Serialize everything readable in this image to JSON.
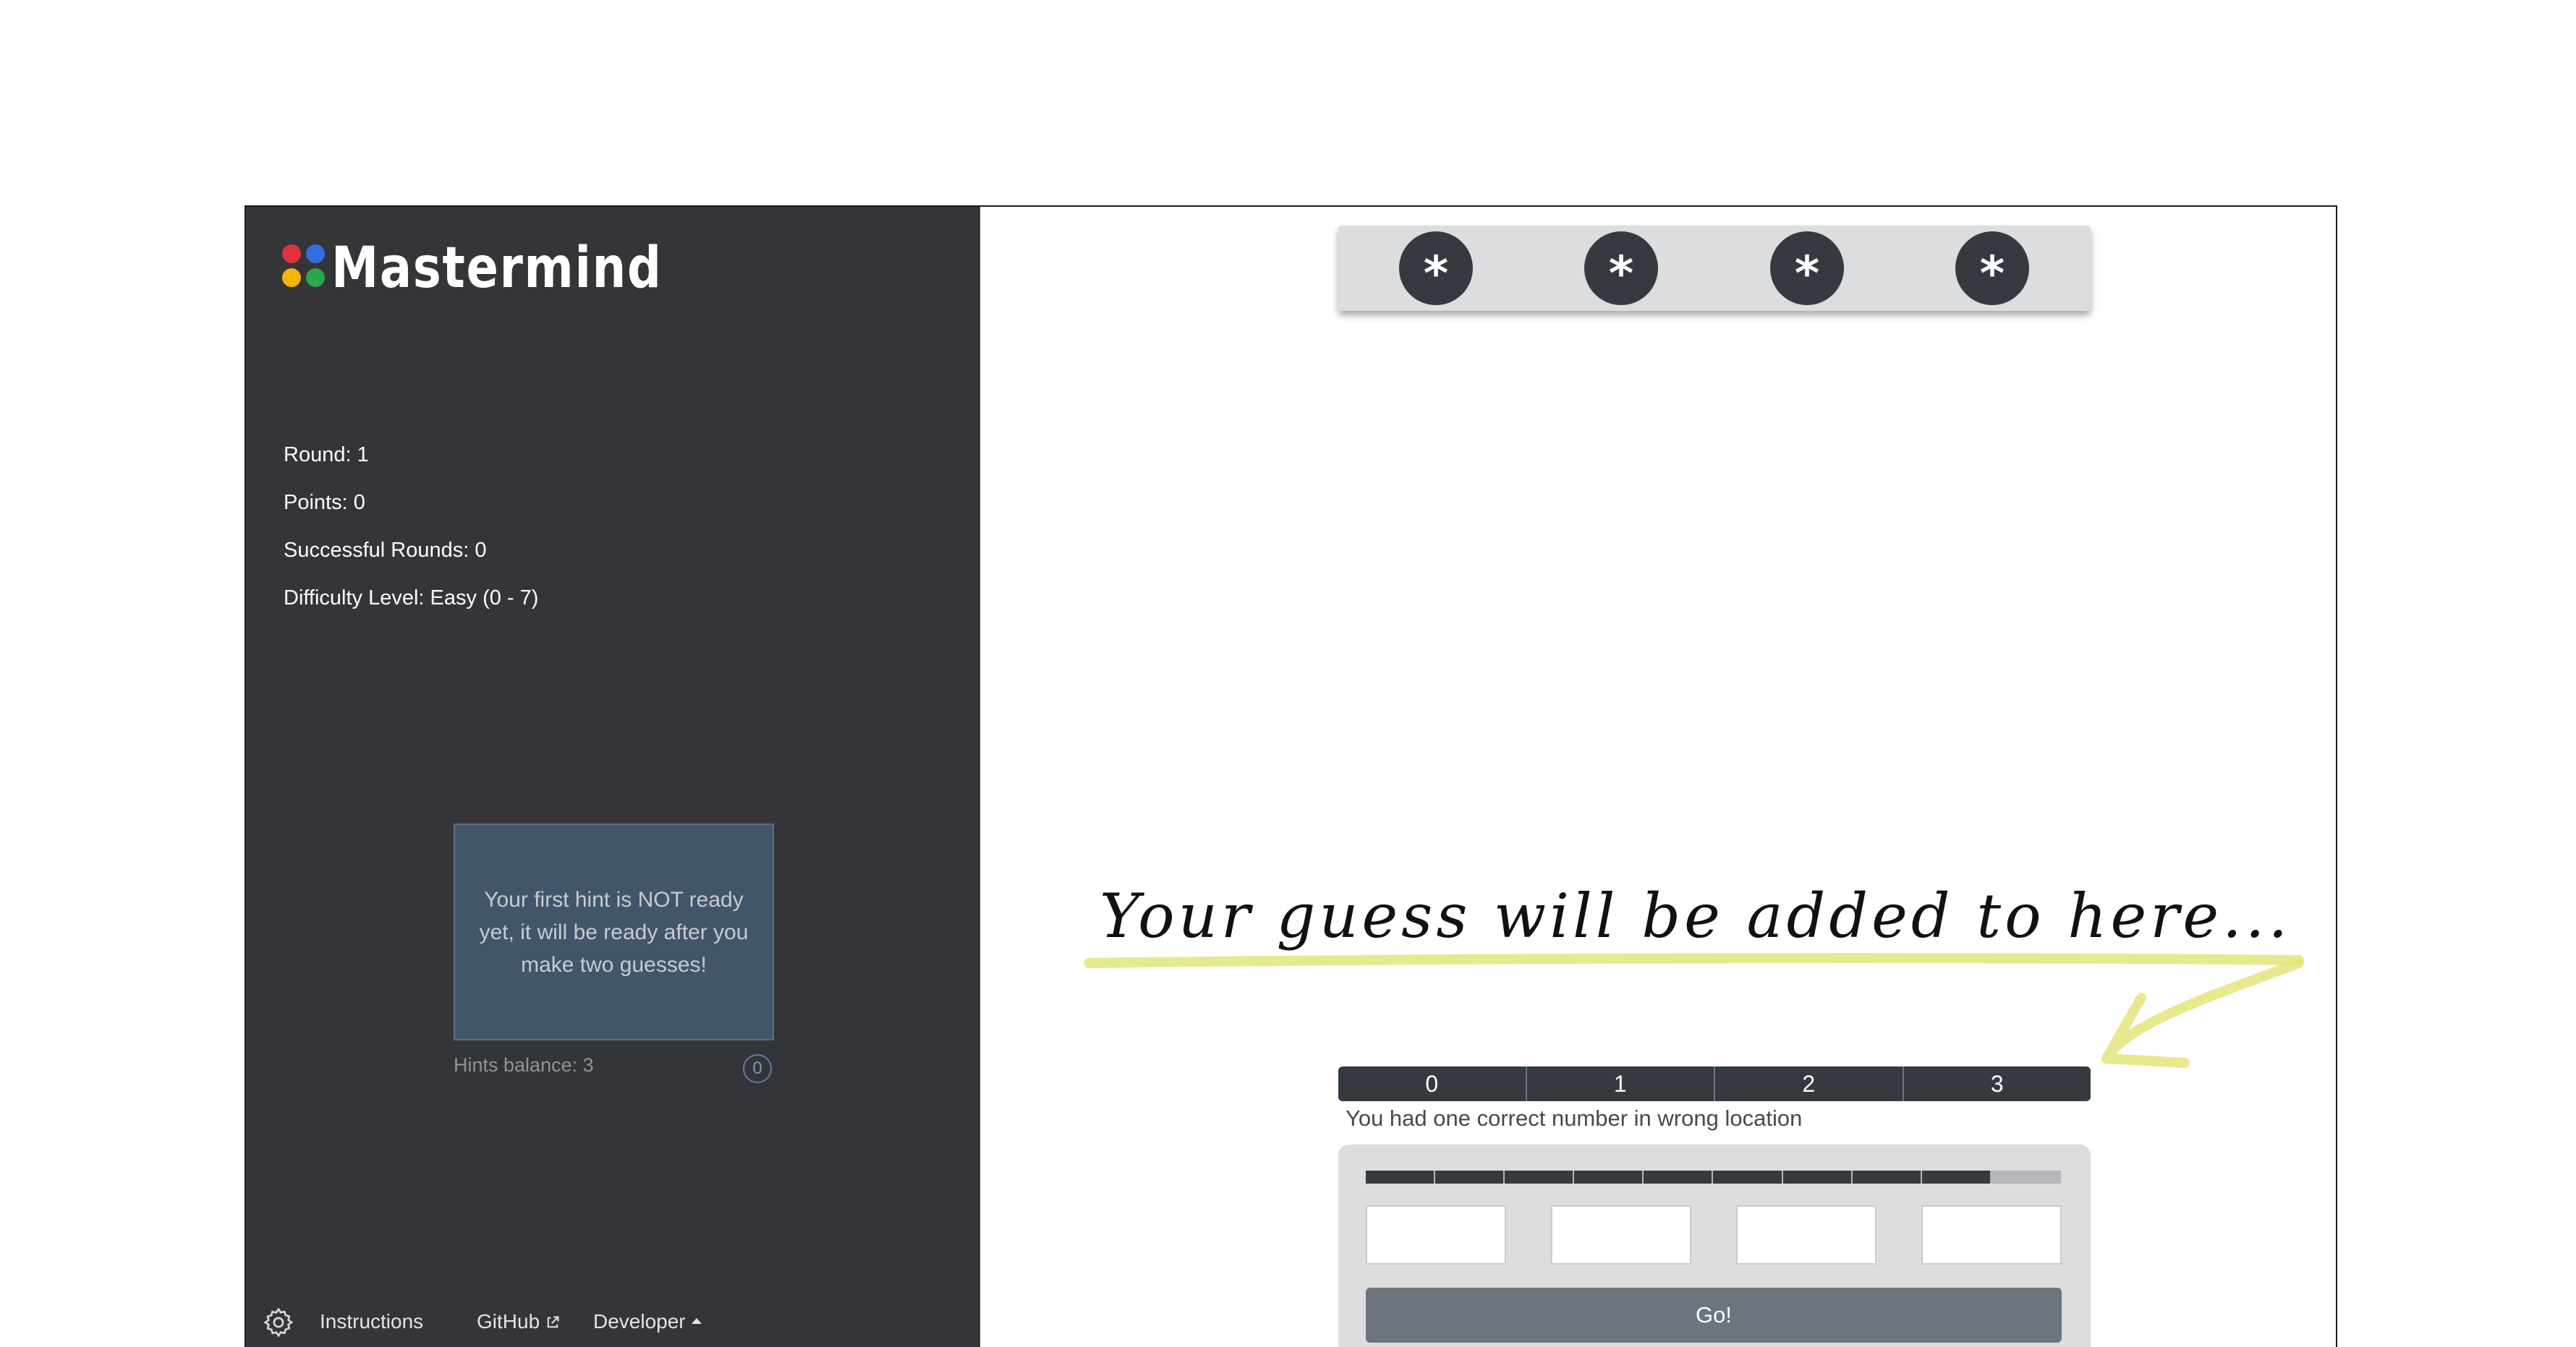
{
  "app": {
    "title": "Mastermind",
    "logo_colors": [
      "#e0323c",
      "#2f6fde",
      "#f5b400",
      "#2aa84a"
    ]
  },
  "sidebar": {
    "stats": {
      "round": "Round: 1",
      "points": "Points: 0",
      "successful_rounds": "Successful Rounds: 0",
      "difficulty": "Difficulty Level: Easy (0 - 7)"
    },
    "hint": {
      "message": "Your first hint is NOT ready yet, it will be ready after you make two guesses!",
      "balance_label": "Hints balance: 3",
      "count": "0"
    },
    "footer": {
      "settings_icon": "gear-icon",
      "instructions": "Instructions",
      "github": "GitHub",
      "github_icon": "external-link-icon",
      "developer": "Developer",
      "developer_icon": "caret-up-icon"
    }
  },
  "board": {
    "secret": [
      "*",
      "*",
      "*",
      "*"
    ],
    "annotation": "Your guess will be added to here...",
    "history_columns": [
      "0",
      "1",
      "2",
      "3"
    ],
    "feedback": "You had one correct number in wrong location",
    "attempts": {
      "used": 9,
      "total": 10
    },
    "inputs": [
      {
        "value": "",
        "placeholder": ""
      },
      {
        "value": "",
        "placeholder": ""
      },
      {
        "value": "",
        "placeholder": ""
      },
      {
        "value": "",
        "placeholder": ""
      }
    ],
    "go_label": "Go!"
  },
  "colors": {
    "sidebar_bg": "#343538",
    "peg": "#343a40",
    "panel": "#dcdddf",
    "go_button": "#6c757d",
    "hint_card": "#435569",
    "highlight": "#e4e57a"
  }
}
